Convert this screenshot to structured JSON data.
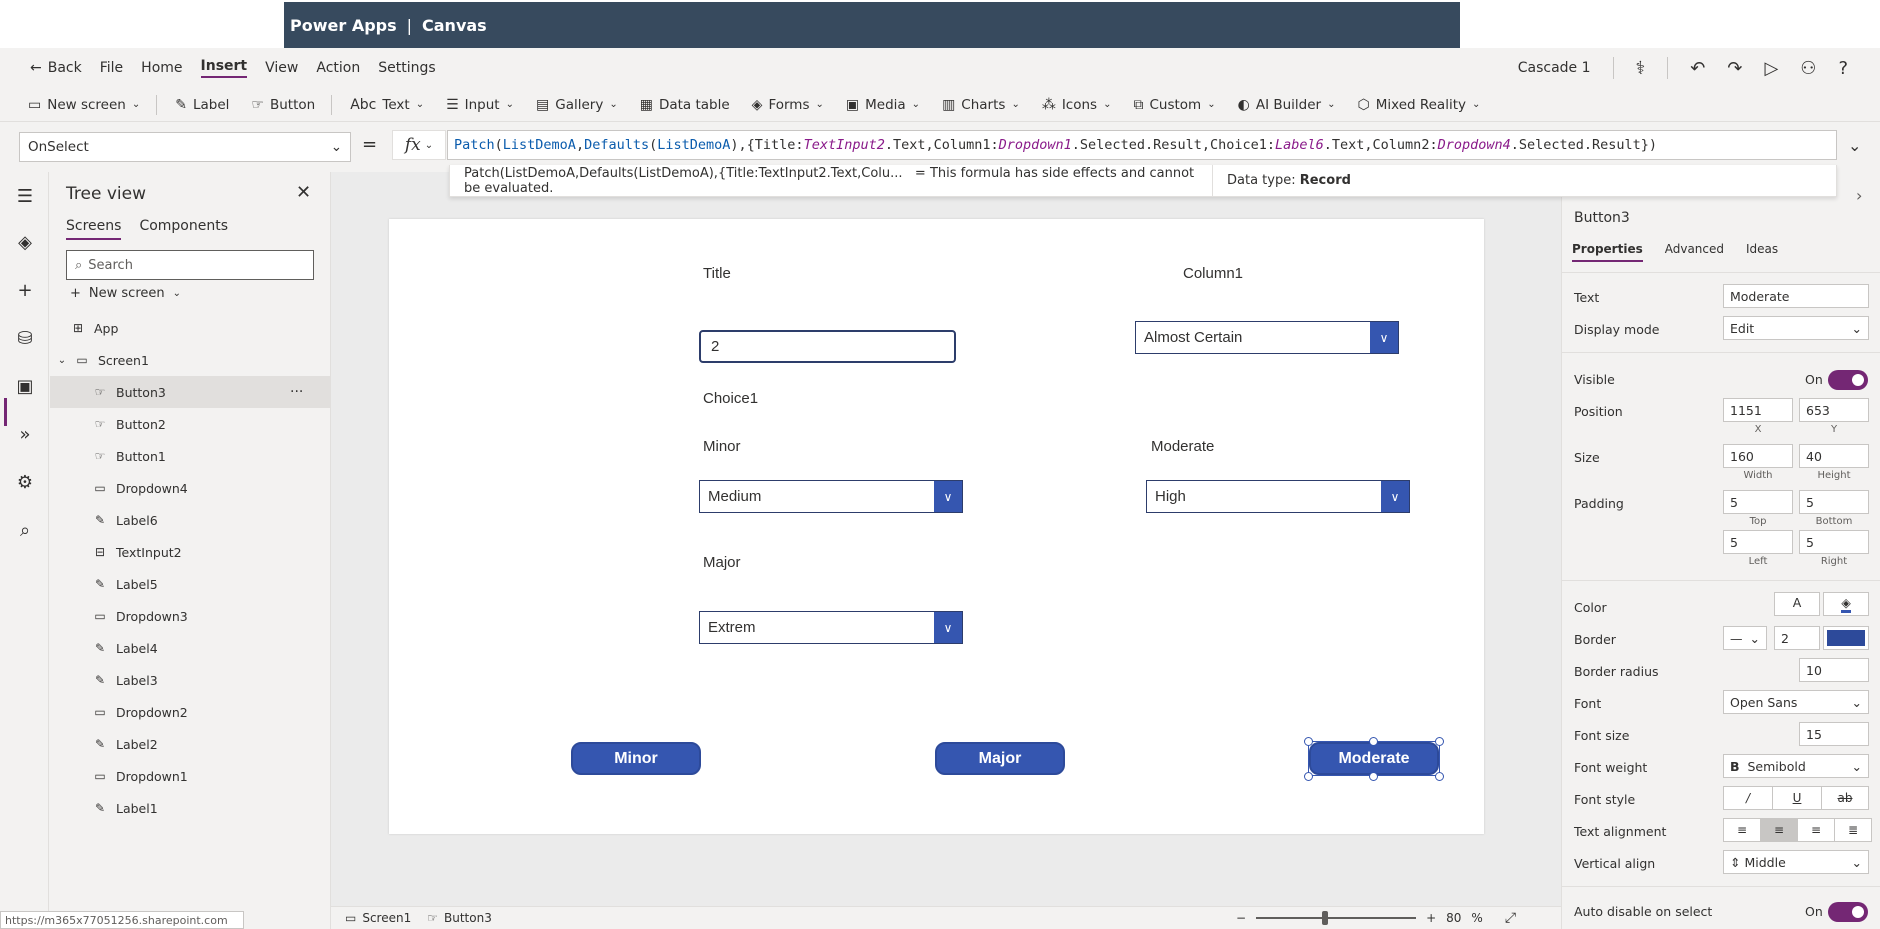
{
  "app": {
    "brand": "Power Apps",
    "separator": "|",
    "mode": "Canvas"
  },
  "menu": {
    "back": "Back",
    "items": [
      "File",
      "Home",
      "Insert",
      "View",
      "Action",
      "Settings"
    ],
    "active": "Insert",
    "app_name": "Cascade 1"
  },
  "ribbon": {
    "items": [
      {
        "label": "New screen",
        "icon": "new-screen-icon",
        "dropdown": true
      },
      {
        "label": "Label",
        "icon": "label-icon",
        "dropdown": false
      },
      {
        "label": "Button",
        "icon": "button-icon",
        "dropdown": false
      },
      {
        "label": "Text",
        "icon": "text-icon",
        "dropdown": true
      },
      {
        "label": "Input",
        "icon": "input-icon",
        "dropdown": true
      },
      {
        "label": "Gallery",
        "icon": "gallery-icon",
        "dropdown": true
      },
      {
        "label": "Data table",
        "icon": "data-table-icon",
        "dropdown": false
      },
      {
        "label": "Forms",
        "icon": "forms-icon",
        "dropdown": true
      },
      {
        "label": "Media",
        "icon": "media-icon",
        "dropdown": true
      },
      {
        "label": "Charts",
        "icon": "charts-icon",
        "dropdown": true
      },
      {
        "label": "Icons",
        "icon": "icons-icon",
        "dropdown": true
      },
      {
        "label": "Custom",
        "icon": "custom-icon",
        "dropdown": true
      },
      {
        "label": "AI Builder",
        "icon": "ai-builder-icon",
        "dropdown": true
      },
      {
        "label": "Mixed Reality",
        "icon": "mixed-reality-icon",
        "dropdown": true
      }
    ]
  },
  "formula": {
    "property": "OnSelect",
    "eq": "=",
    "fx": "fx",
    "hint_preview": "Patch(ListDemoA,Defaults(ListDemoA),{Title:TextInput2.Text,Colu...",
    "hint_message": "=  This formula has side effects and cannot be evaluated.",
    "data_type_label": "Data type:",
    "data_type_value": "Record"
  },
  "tree": {
    "title": "Tree view",
    "tabs": [
      "Screens",
      "Components"
    ],
    "search_placeholder": "Search",
    "new_screen": "New screen",
    "app": "App",
    "screen": "Screen1",
    "items": [
      "Button3",
      "Button2",
      "Button1",
      "Dropdown4",
      "Label6",
      "TextInput2",
      "Label5",
      "Dropdown3",
      "Label4",
      "Label3",
      "Dropdown2",
      "Label2",
      "Dropdown1",
      "Label1"
    ],
    "selected": "Button3",
    "more": "···"
  },
  "canvas": {
    "labels": {
      "title": "Title",
      "column1": "Column1",
      "choice1": "Choice1",
      "minor": "Minor",
      "moderate": "Moderate",
      "major": "Major"
    },
    "text_input_value": "2",
    "dropdowns": {
      "column1": "Almost Certain",
      "minor": "Medium",
      "moderate": "High",
      "major": "Extrem"
    },
    "buttons": [
      "Minor",
      "Major",
      "Moderate"
    ]
  },
  "status": {
    "screen": "Screen1",
    "control": "Button3",
    "zoom_minus": "−",
    "zoom_plus": "+",
    "zoom": "80",
    "zoom_unit": "%"
  },
  "url": "https://m365x77051256.sharepoint.com",
  "props": {
    "control": "Button3",
    "tabs": [
      "Properties",
      "Advanced",
      "Ideas"
    ],
    "text_label": "Text",
    "text": "Moderate",
    "display_mode_label": "Display mode",
    "display_mode": "Edit",
    "visible_label": "Visible",
    "visible": "On",
    "position_label": "Position",
    "x": "1151",
    "y": "653",
    "x_label": "X",
    "y_label": "Y",
    "size_label": "Size",
    "width": "160",
    "height": "40",
    "width_label": "Width",
    "height_label": "Height",
    "padding_label": "Padding",
    "pad_top": "5",
    "pad_bottom": "5",
    "pad_left": "5",
    "pad_right": "5",
    "top_label": "Top",
    "bottom_label": "Bottom",
    "left_label": "Left",
    "right_label": "Right",
    "color_label": "Color",
    "color_a": "A",
    "border_label": "Border",
    "border_width": "2",
    "border_color": "#2d4a9a",
    "radius_label": "Border radius",
    "radius": "10",
    "font_label": "Font",
    "font": "Open Sans",
    "font_size_label": "Font size",
    "font_size": "15",
    "font_weight_label": "Font weight",
    "font_weight": "Semibold",
    "font_weight_b": "B",
    "font_style_label": "Font style",
    "text_align_label": "Text alignment",
    "valign_label": "Vertical align",
    "valign": "Middle",
    "auto_disable_label": "Auto disable on select",
    "auto_disable": "On"
  },
  "colors": {
    "accent": "#742774",
    "topbar": "#374a5e",
    "button": "#3556b0"
  }
}
